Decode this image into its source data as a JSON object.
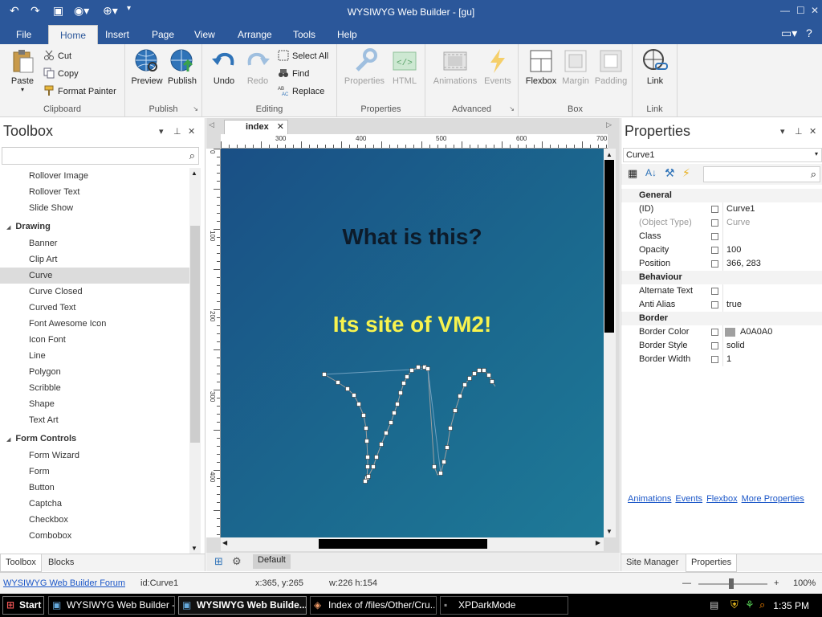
{
  "window": {
    "title": "WYSIWYG Web Builder - [gu]"
  },
  "ribbon_tabs": [
    "File",
    "Home",
    "Insert",
    "Page",
    "View",
    "Arrange",
    "Tools",
    "Help"
  ],
  "ribbon": {
    "clipboard": {
      "label": "Clipboard",
      "paste": "Paste",
      "cut": "Cut",
      "copy": "Copy",
      "format_painter": "Format Painter"
    },
    "publish": {
      "label": "Publish",
      "preview": "Preview",
      "publish": "Publish"
    },
    "editing": {
      "label": "Editing",
      "undo": "Undo",
      "redo": "Redo",
      "select_all": "Select All",
      "find": "Find",
      "replace": "Replace"
    },
    "properties": {
      "label": "Properties",
      "properties": "Properties",
      "html": "HTML"
    },
    "advanced": {
      "label": "Advanced",
      "animations": "Animations",
      "events": "Events"
    },
    "box": {
      "label": "Box",
      "flexbox": "Flexbox",
      "margin": "Margin",
      "padding": "Padding"
    },
    "link": {
      "label": "Link",
      "link": "Link"
    }
  },
  "toolbox": {
    "title": "Toolbox",
    "items": [
      {
        "kind": "item",
        "label": "Rollover Image"
      },
      {
        "kind": "item",
        "label": "Rollover Text"
      },
      {
        "kind": "item",
        "label": "Slide Show"
      },
      {
        "kind": "header",
        "label": "Drawing"
      },
      {
        "kind": "item",
        "label": "Banner"
      },
      {
        "kind": "item",
        "label": "Clip Art"
      },
      {
        "kind": "item",
        "label": "Curve",
        "selected": true
      },
      {
        "kind": "item",
        "label": "Curve Closed"
      },
      {
        "kind": "item",
        "label": "Curved Text"
      },
      {
        "kind": "item",
        "label": "Font Awesome Icon"
      },
      {
        "kind": "item",
        "label": "Icon Font"
      },
      {
        "kind": "item",
        "label": "Line"
      },
      {
        "kind": "item",
        "label": "Polygon"
      },
      {
        "kind": "item",
        "label": "Scribble"
      },
      {
        "kind": "item",
        "label": "Shape"
      },
      {
        "kind": "item",
        "label": "Text Art"
      },
      {
        "kind": "header",
        "label": "Form Controls"
      },
      {
        "kind": "item",
        "label": "Form Wizard"
      },
      {
        "kind": "item",
        "label": "Form"
      },
      {
        "kind": "item",
        "label": "Button"
      },
      {
        "kind": "item",
        "label": "Captcha"
      },
      {
        "kind": "item",
        "label": "Checkbox"
      },
      {
        "kind": "item",
        "label": "Combobox"
      }
    ],
    "bottom_tabs": [
      "Toolbox",
      "Blocks"
    ]
  },
  "editor": {
    "tab": "index",
    "ruler_h": [
      "300",
      "400",
      "500",
      "600",
      "700"
    ],
    "ruler_v": [
      "0",
      "100",
      "200",
      "300",
      "400"
    ],
    "heading": "What is this?",
    "subheading": "Its site of VM2!",
    "page_tab": "Default"
  },
  "properties": {
    "title": "Properties",
    "selected": "Curve1",
    "rows": [
      {
        "type": "cat",
        "key": "General"
      },
      {
        "key": "(ID)",
        "value": "Curve1"
      },
      {
        "key": "(Object Type)",
        "value": "Curve",
        "dim": true
      },
      {
        "key": "Class",
        "value": ""
      },
      {
        "key": "Opacity",
        "value": "100"
      },
      {
        "key": "Position",
        "value": "366, 283"
      },
      {
        "type": "cat",
        "key": "Behaviour"
      },
      {
        "key": "Alternate Text",
        "value": ""
      },
      {
        "key": "Anti Alias",
        "value": "true"
      },
      {
        "type": "cat",
        "key": "Border"
      },
      {
        "key": "Border Color",
        "value": "A0A0A0",
        "swatch": "#a0a0a0"
      },
      {
        "key": "Border Style",
        "value": "solid"
      },
      {
        "key": "Border Width",
        "value": "1"
      }
    ],
    "links": [
      "Animations",
      "Events",
      "Flexbox",
      "More Properties"
    ],
    "bottom_tabs": [
      "Site Manager",
      "Properties"
    ]
  },
  "status": {
    "forum_link": "WYSIWYG Web Builder Forum",
    "id": "id:Curve1",
    "coords": "x:365, y:265",
    "size": "w:226 h:154",
    "zoom": "100%"
  },
  "taskbar": {
    "start": "Start",
    "buttons": [
      "WYSIWYG Web Builder - ...",
      "WYSIWYG Web Builde...",
      "Index of /files/Other/Cru...",
      "XPDarkMode"
    ],
    "clock": "1:35 PM"
  }
}
